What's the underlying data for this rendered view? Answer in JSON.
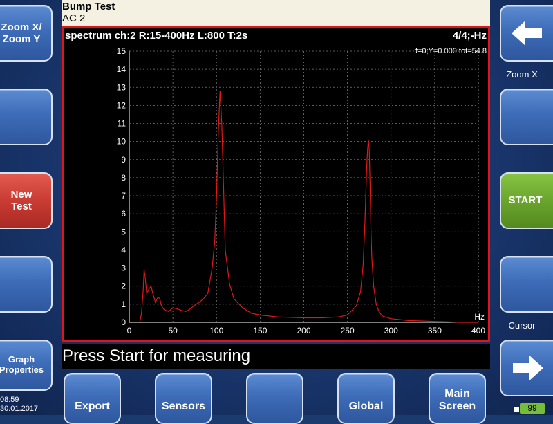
{
  "header": {
    "title": "Bump Test",
    "subtitle": "AC 2"
  },
  "left_buttons": {
    "zoom_xy": "Zoom X/\nZoom Y",
    "new_test": "New\nTest",
    "graph_properties": "Graph\nProperties"
  },
  "right_buttons": {
    "zoom_x_label": "Zoom X",
    "start": "START",
    "cursor_label": "Cursor"
  },
  "bottom_buttons": {
    "export": "Export",
    "sensors": "Sensors",
    "global": "Global",
    "main_screen": "Main\nScreen"
  },
  "status_text": "Press Start for measuring",
  "clock": {
    "time": "08:59",
    "date": "30.01.2017"
  },
  "counter": "99",
  "colors": {
    "accent_red": "#e0141a",
    "trace": "#e01818",
    "start_green": "#6aa52e",
    "new_test_red": "#c93c33"
  },
  "icons": {
    "back": "arrow-left-icon",
    "next": "arrow-right-icon"
  },
  "chart_data": {
    "type": "line",
    "title": "spectrum ch:2 R:15-400Hz L:800 T:2s",
    "top_right": "4/4;-Hz",
    "readout": "f=0;Y=0.000;tot=54.8",
    "xlabel": "Hz",
    "ylabel": "",
    "xlim": [
      0,
      400
    ],
    "ylim": [
      0,
      15
    ],
    "x_ticks": [
      0,
      50,
      100,
      150,
      200,
      250,
      300,
      350,
      400
    ],
    "y_ticks": [
      0,
      1,
      2,
      3,
      4,
      5,
      6,
      7,
      8,
      9,
      10,
      11,
      12,
      13,
      14,
      15
    ],
    "grid": true,
    "series": [
      {
        "x": [
          12,
          14,
          16,
          17,
          18,
          20,
          22,
          25,
          27,
          30,
          33,
          35,
          37,
          40,
          45,
          50,
          55,
          60,
          65,
          70,
          75,
          80,
          85,
          90,
          95,
          98,
          100,
          102,
          104,
          106,
          108,
          110,
          115,
          120,
          130,
          140,
          150,
          170,
          200,
          220,
          240,
          250,
          260,
          265,
          268,
          270,
          272,
          273,
          274,
          275,
          276,
          277,
          278,
          280,
          283,
          286,
          290,
          300,
          320,
          350,
          380,
          400
        ],
        "y": [
          0.0,
          0.5,
          1.8,
          2.9,
          2.6,
          1.6,
          1.8,
          2.0,
          1.6,
          1.1,
          1.4,
          1.3,
          0.9,
          0.7,
          0.6,
          0.8,
          0.75,
          0.65,
          0.6,
          0.75,
          0.95,
          1.1,
          1.3,
          1.6,
          3.0,
          4.5,
          7.0,
          10.5,
          12.8,
          11.0,
          7.5,
          4.0,
          2.1,
          1.3,
          0.8,
          0.5,
          0.4,
          0.3,
          0.25,
          0.25,
          0.3,
          0.4,
          0.9,
          1.7,
          3.2,
          5.5,
          8.5,
          9.5,
          10.1,
          9.5,
          7.5,
          5.0,
          3.5,
          2.0,
          1.0,
          0.6,
          0.35,
          0.2,
          0.1,
          0.05,
          0.0,
          0.0
        ]
      }
    ]
  }
}
